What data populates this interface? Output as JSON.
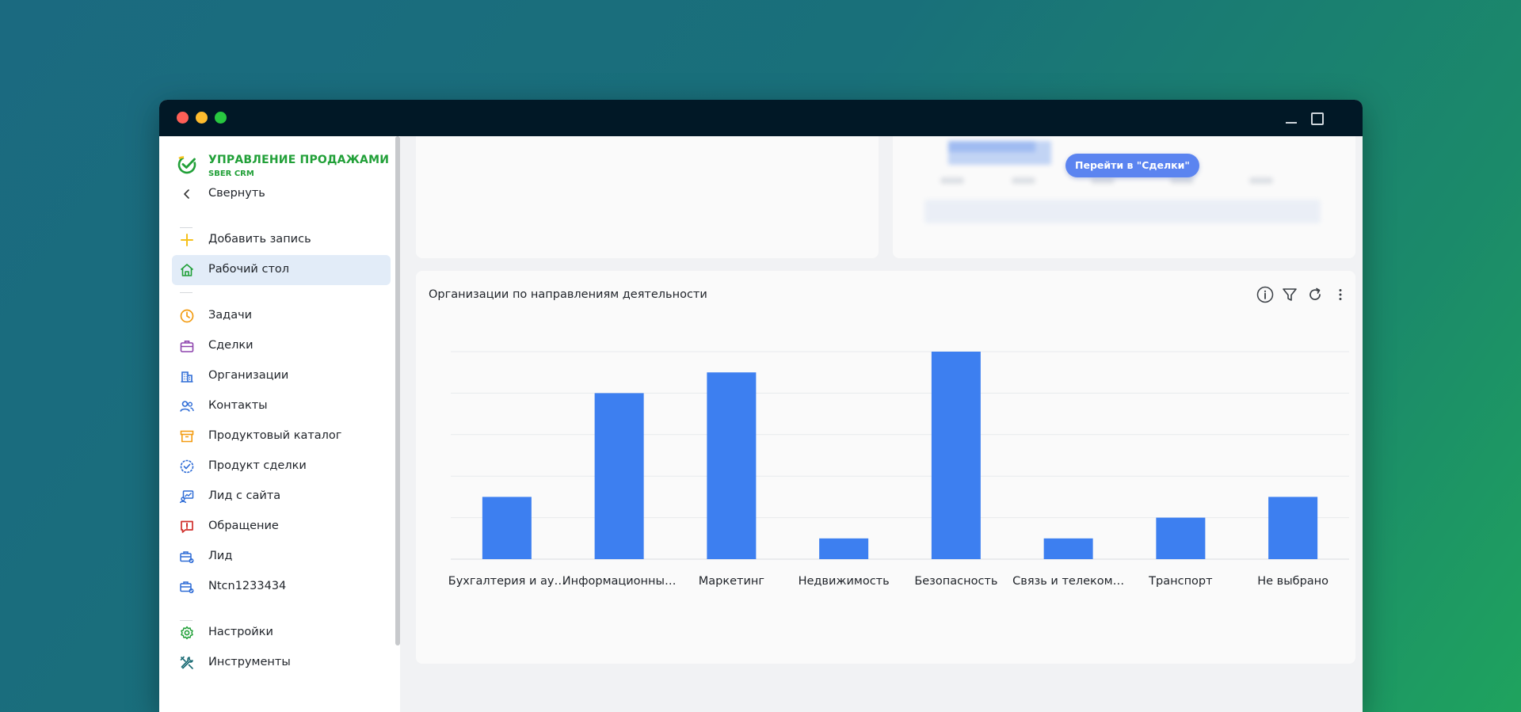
{
  "brand": {
    "title": "УПРАВЛЕНИЕ ПРОДАЖАМИ",
    "subtitle": "SBER CRM",
    "color": "#21a038"
  },
  "sidebar": {
    "collapse_label": "Свернуть",
    "items": [
      {
        "label": "Добавить запись",
        "icon": "plus-icon",
        "color": "#f5c11b"
      },
      {
        "label": "Рабочий стол",
        "icon": "home-icon",
        "color": "#21a038",
        "active": true
      },
      {
        "label": "Задачи",
        "icon": "clock-icon",
        "color": "#f39c12"
      },
      {
        "label": "Сделки",
        "icon": "briefcase-icon",
        "color": "#8e44ad"
      },
      {
        "label": "Организации",
        "icon": "building-icon",
        "color": "#2d6bd6"
      },
      {
        "label": "Контакты",
        "icon": "people-icon",
        "color": "#2d6bd6"
      },
      {
        "label": "Продуктовый каталог",
        "icon": "box-icon",
        "color": "#f39c12"
      },
      {
        "label": "Продукт сделки",
        "icon": "check-badge-icon",
        "color": "#2d6bd6"
      },
      {
        "label": "Лид с сайта",
        "icon": "chart-screen-icon",
        "color": "#2d6bd6"
      },
      {
        "label": "Обращение",
        "icon": "alert-message-icon",
        "color": "#d0312d"
      },
      {
        "label": "Лид",
        "icon": "briefcase-badge-icon",
        "color": "#2d6bd6"
      },
      {
        "label": "Ntcn1233434",
        "icon": "briefcase-badge-icon",
        "color": "#2d6bd6"
      },
      {
        "label": "Настройки",
        "icon": "gear-icon",
        "color": "#21a038"
      },
      {
        "label": "Инструменты",
        "icon": "tools-icon",
        "color": "#1a6b74"
      }
    ]
  },
  "top_right_card": {
    "button_label": "Перейти в \"Сделки\""
  },
  "chart_card": {
    "title": "Организации по направлениям деятельности",
    "tools": [
      "info-icon",
      "filter-icon",
      "refresh-icon",
      "more-vertical-icon"
    ]
  },
  "chart_data": {
    "type": "bar",
    "title": "Организации по направлениям деятельности",
    "categories": [
      "Бухгалтерия и ау…",
      "Информационны…",
      "Маркетинг",
      "Недвижимость",
      "Безопасность",
      "Связь и телеком…",
      "Транспорт",
      "Не выбрано"
    ],
    "values": [
      3,
      8,
      9,
      1,
      10,
      1,
      2,
      3
    ],
    "ylim": [
      0,
      10
    ],
    "grid": true,
    "bar_color": "#3d7ff0",
    "xlabel": "",
    "ylabel": ""
  }
}
